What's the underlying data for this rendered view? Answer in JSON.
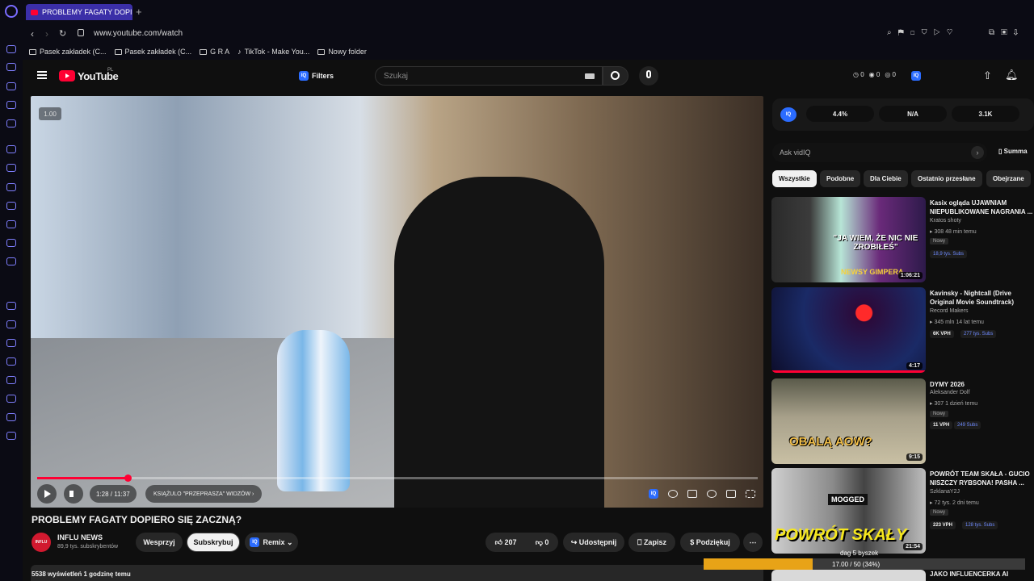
{
  "browser": {
    "tab_title": "PROBLEMY FAGATY DOPIE",
    "url": "www.youtube.com/watch",
    "bookmarks": [
      "Pasek zakładek (C...",
      "Pasek zakładek (C...",
      "G R A",
      "TikTok - Make You...",
      "Nowy folder"
    ]
  },
  "youtube": {
    "logo_text": "YouTube",
    "logo_region": "PL",
    "filters_label": "Filters",
    "search_placeholder": "Szukaj",
    "header_stats": [
      "0",
      "0",
      "0"
    ]
  },
  "player": {
    "speed": "1.00",
    "time": "1:28 / 11:37",
    "chapter": "KSIĄŻULO \"PRZEPRASZA\" WIDZÓW",
    "progress_fraction": 0.126
  },
  "video": {
    "title": "PROBLEMY FAGATY DOPIERO SIĘ ZACZNĄ?",
    "channel": "INFLU NEWS",
    "channel_avatar_text": "INFLU",
    "subscribers": "89,9 tys. subskrybentów",
    "support_label": "Wesprzyj",
    "subscribe_label": "Subskrybuj",
    "remix_label": "Remix",
    "likes": "207",
    "dislikes": "0",
    "share_label": "Udostępnij",
    "save_label": "Zapisz",
    "thanks_label": "Podziękuj",
    "views_line": "5538 wyświetleń  1 godzinę temu"
  },
  "side_panel": {
    "metrics": [
      "4.4%",
      "N/A",
      "3.1K"
    ],
    "ask_placeholder": "Ask vidIQ",
    "summary_label": "Summa",
    "chips": [
      "Wszystkie",
      "Podobne",
      "Dla Ciebie",
      "Ostatnio przesłane",
      "Obejrzane"
    ],
    "recommendations": [
      {
        "title": "Kasix ogląda UJAWNIAM NIEPUBLIKOWANE NAGRANIA ...",
        "channel": "Kratos shoty",
        "meta": "308  48 min temu",
        "badge": "Nowy",
        "vph": "18,9 tys. Subs",
        "subs": "",
        "duration": "1:06:21",
        "thumb_text": "\"JA WIEM, ŻE NIC NIE ZROBIŁEŚ\"",
        "thumb_sub": "NEWSY GIMPERA"
      },
      {
        "title": "Kavinsky - Nightcall (Drive Original Movie Soundtrack) (Official Audio)",
        "channel": "Record Makers",
        "meta": "345 mln  14 lat temu",
        "badge": "",
        "vph": "6K VPH",
        "subs": "277 tys. Subs",
        "duration": "4:17",
        "thumb_text": "",
        "thumb_sub": ""
      },
      {
        "title": "DYMY 2026",
        "channel": "Aleksander Dolf",
        "meta": "307  1 dzień temu",
        "badge": "Nowy",
        "vph": "11 VPH",
        "subs": "249 Subs",
        "duration": "9:15",
        "thumb_text": "OBALĄ AOW?",
        "thumb_sub": ""
      },
      {
        "title": "POWRÓT TEAM SKAŁA - GUCIO NISZCZY RYBSONA! PASHA ...",
        "channel": "SzklanaY2J",
        "meta": "72 tys.  2 dni temu",
        "badge": "Nowy",
        "vph": "223 VPH",
        "subs": "128 tys. Subs",
        "duration": "21:54",
        "thumb_text": "POWRÓT SKAŁY",
        "thumb_sub": "MOGGED"
      }
    ],
    "last_title": "JAKO INFLUENCERKA AI"
  },
  "download": {
    "label": "dag 5 byszek",
    "progress_text": "17.00 / 50 (34%)",
    "fraction": 0.34
  }
}
